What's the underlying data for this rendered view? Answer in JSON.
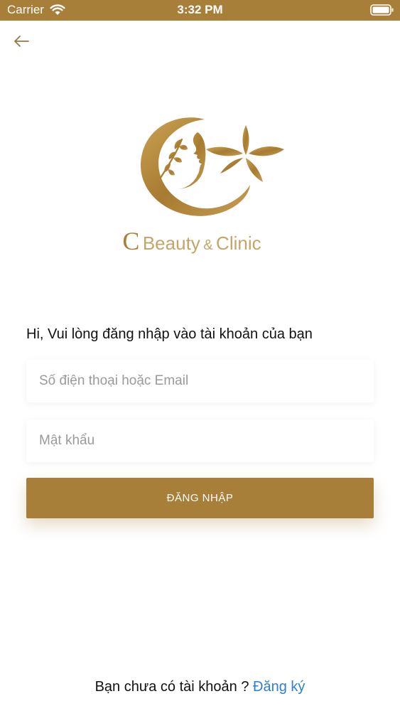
{
  "status_bar": {
    "carrier": "Carrier",
    "time": "3:32 PM",
    "wifi_icon": "wifi-icon",
    "battery_icon": "battery-icon",
    "background_color": "#a87f38"
  },
  "nav": {
    "back_icon": "arrow-left-icon"
  },
  "logo": {
    "letter": "C",
    "name": "Beauty",
    "ampersand": "&",
    "name2": "Clinic",
    "color": "#b08a45"
  },
  "form": {
    "greeting": "Hi, Vui lòng đăng nhập vào tài khoản của bạn",
    "phone_placeholder": "Số điện thoại hoặc Email",
    "password_placeholder": "Mật khẩu",
    "login_label": "ĐĂNG NHẬP",
    "accent_color": "#a87f38"
  },
  "footer": {
    "prompt": "Bạn chưa có tài khoản ? ",
    "register_label": "Đăng ký",
    "link_color": "#2e7fd4"
  }
}
